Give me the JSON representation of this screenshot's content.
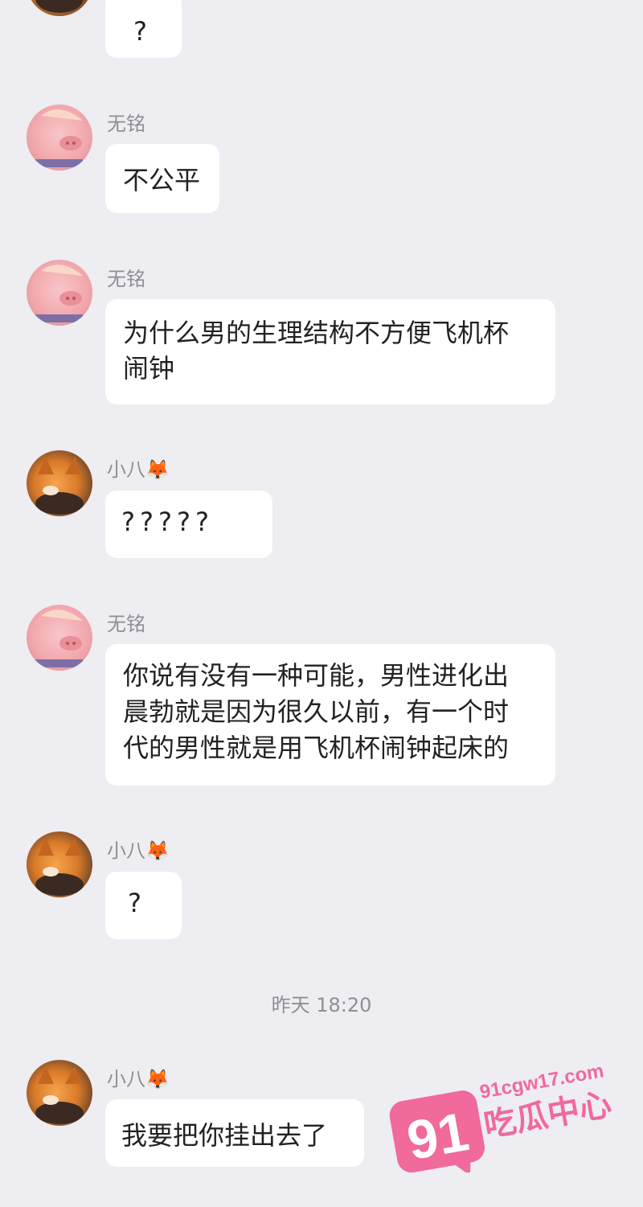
{
  "messages": [
    {
      "sender": "",
      "text": "?"
    },
    {
      "sender": "无铭",
      "text": "不公平"
    },
    {
      "sender": "无铭",
      "lines": [
        "为什么男的生理结构不方便飞机杯",
        "闹钟"
      ]
    },
    {
      "sender": "小八🦊",
      "text": "?????"
    },
    {
      "sender": "无铭",
      "lines": [
        "你说有没有一种可能，男性进化出",
        "晨勃就是因为很久以前，有一个时",
        "代的男性就是用飞机杯闹钟起床的"
      ]
    },
    {
      "sender": "小八🦊",
      "text": "?"
    },
    {
      "sender": "小八🦊",
      "text": "我要把你挂出去了"
    }
  ],
  "timestamp": "昨天 18:20",
  "watermark": {
    "number": "91",
    "site": "91cgw17.com",
    "label": "吃瓜中心",
    "color": "#f06a9c"
  },
  "colors": {
    "background": "#ededf2",
    "bubble": "#ffffff",
    "meta_text": "#8e8e93"
  }
}
